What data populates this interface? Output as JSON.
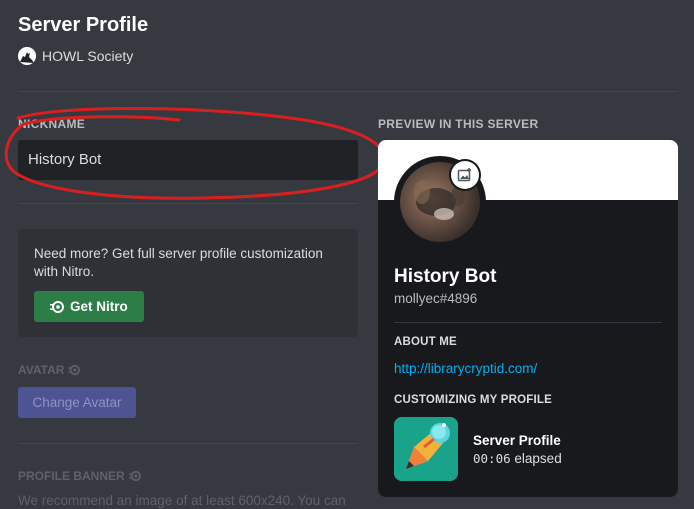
{
  "page": {
    "title": "Server Profile"
  },
  "server": {
    "name": "HOWL Society",
    "icon": "wolf-howl-icon"
  },
  "nickname": {
    "label": "NICKNAME",
    "value": "History Bot"
  },
  "nitro_promo": {
    "text": "Need more? Get full server profile customization with Nitro.",
    "button_label": "Get Nitro",
    "button_color": "#2d7d46"
  },
  "avatar_section": {
    "label": "AVATAR",
    "button_label": "Change Avatar"
  },
  "banner_section": {
    "label": "PROFILE BANNER",
    "description": "We recommend an image of at least 600x240. You can"
  },
  "preview": {
    "label": "PREVIEW IN THIS SERVER",
    "display_name": "History Bot",
    "tag": "mollyec#4896",
    "about_me_label": "ABOUT ME",
    "about_me_link": "http://librarycryptid.com/",
    "customizing_label": "CUSTOMIZING MY PROFILE",
    "activity_title": "Server Profile",
    "activity_elapsed_time": "00:06",
    "activity_elapsed_suffix": "elapsed"
  },
  "colors": {
    "background": "#36393f",
    "card": "#18191c",
    "link": "#00aff4",
    "annotation": "#d92020"
  }
}
